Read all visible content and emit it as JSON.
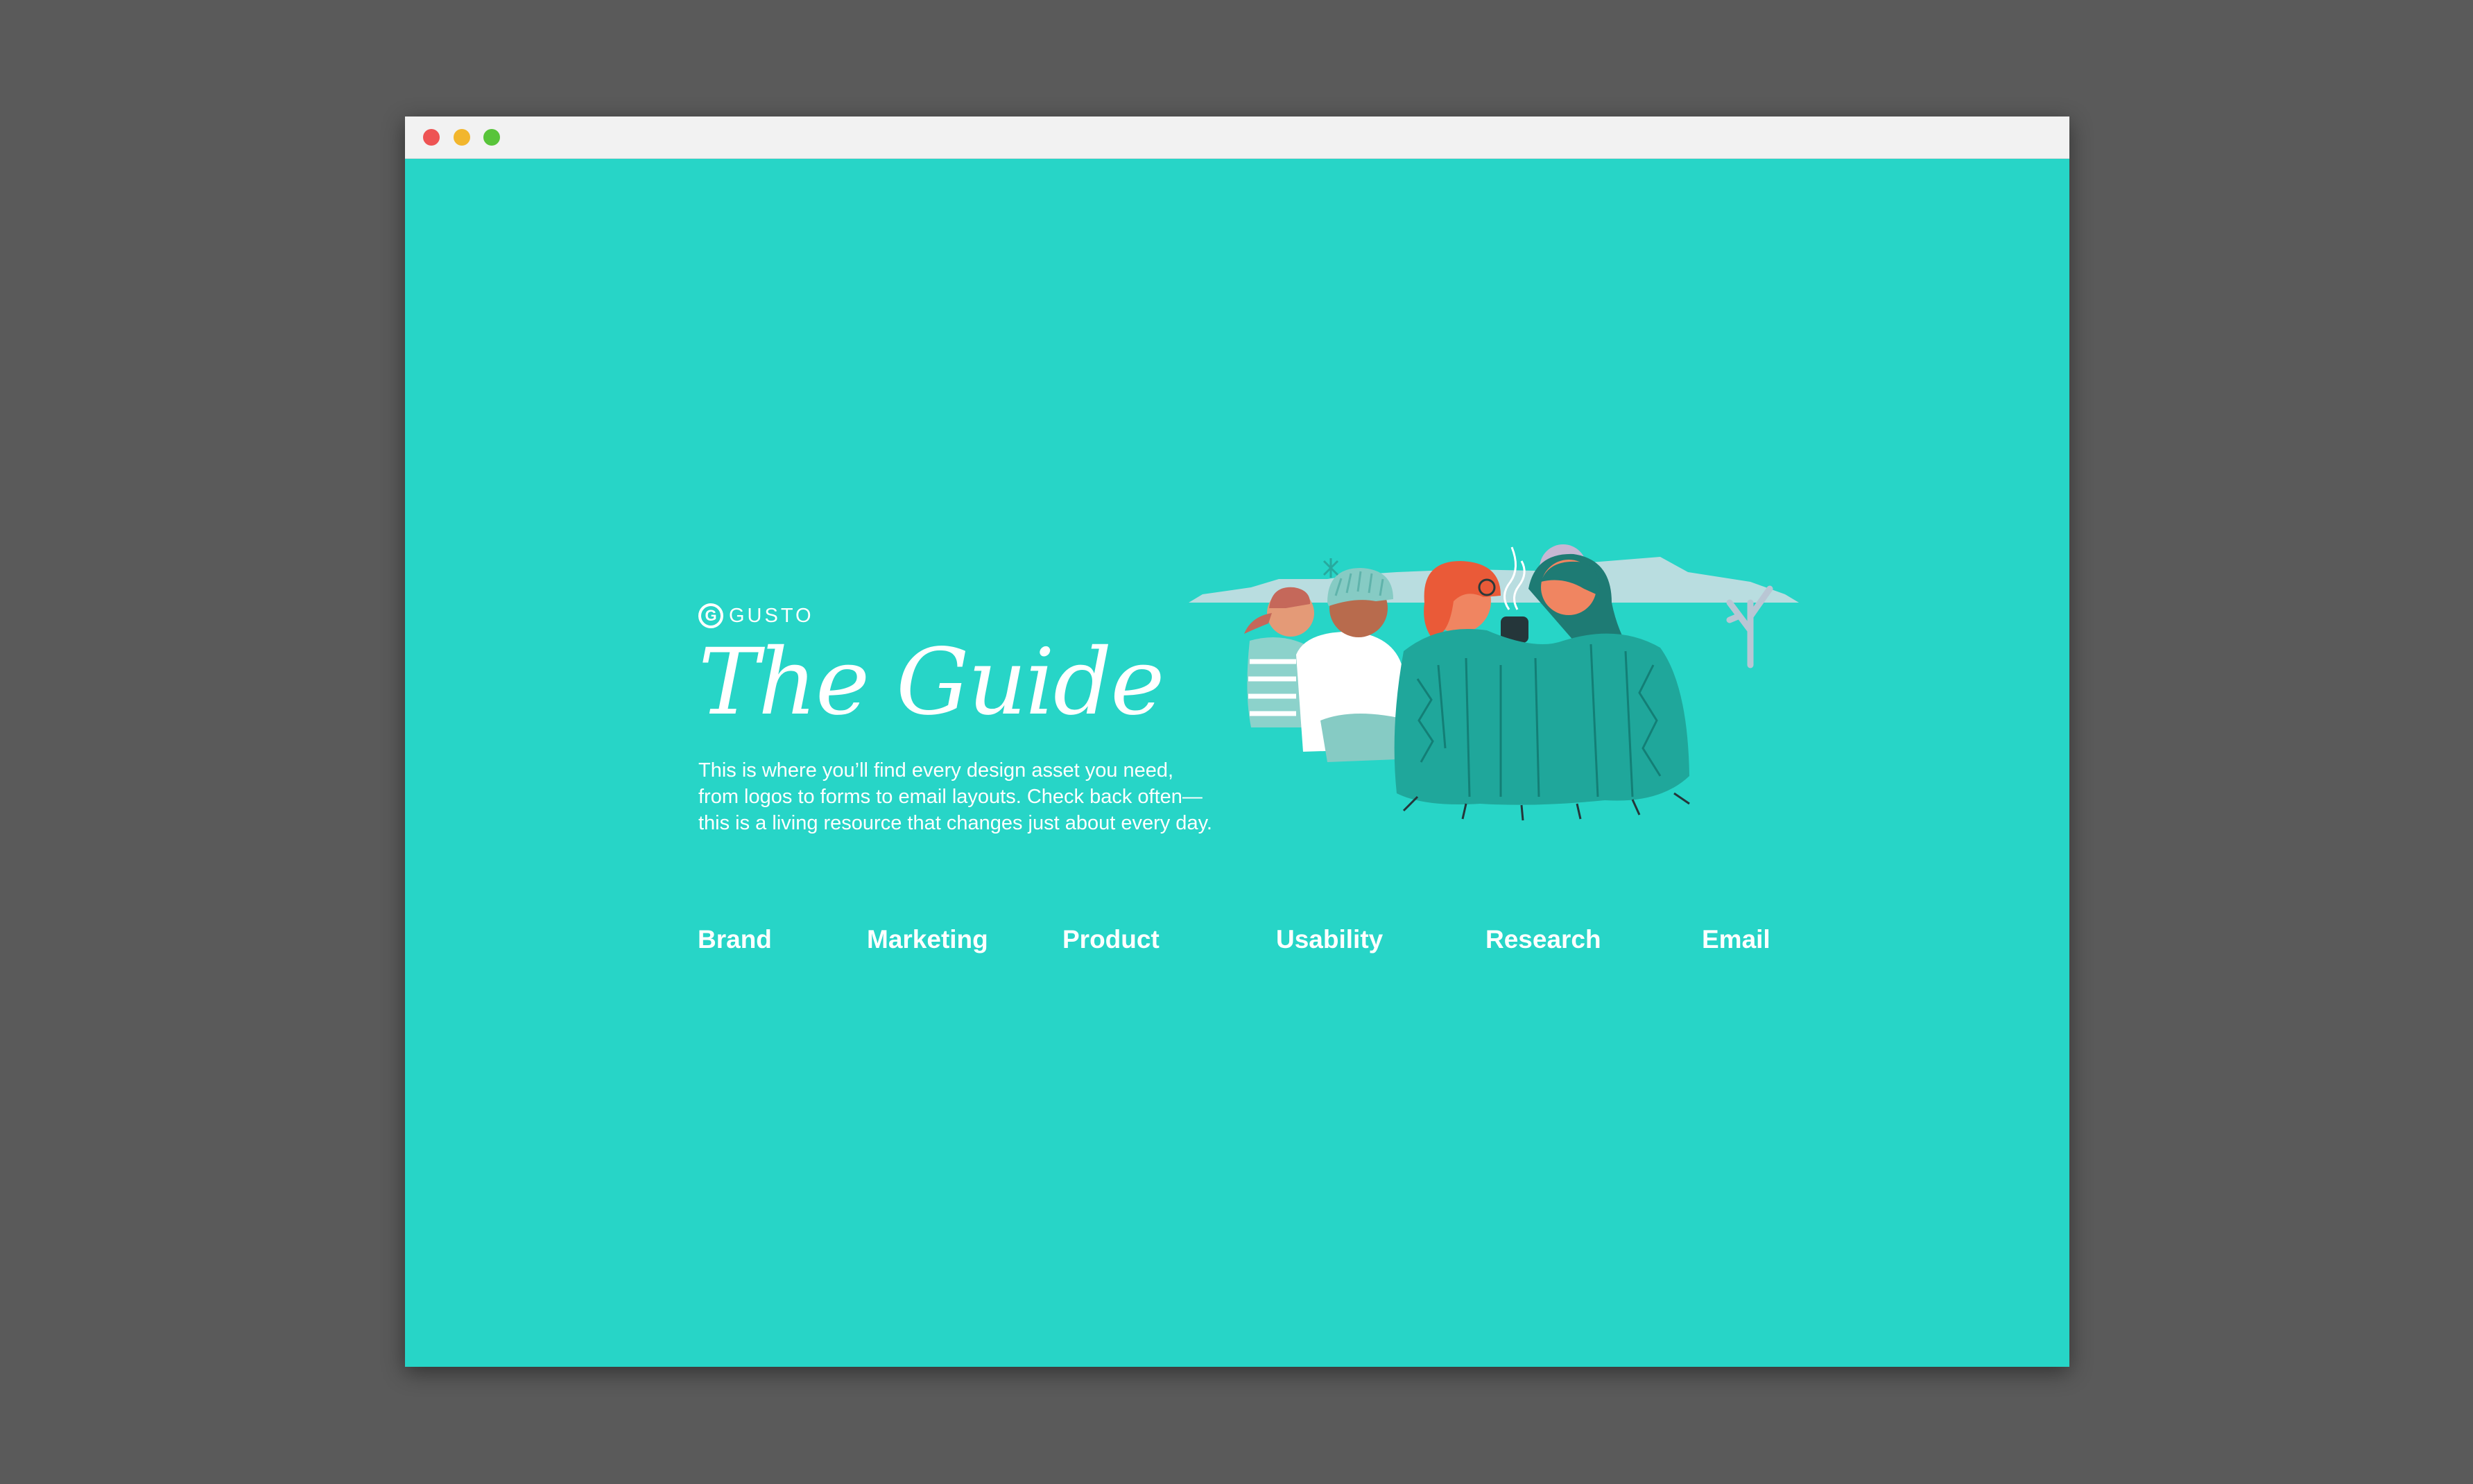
{
  "window": {
    "controls": [
      "close",
      "minimize",
      "maximize"
    ]
  },
  "brand": {
    "logo_letter": "G",
    "logo_text": "GUSTO"
  },
  "hero": {
    "title": "The Guide",
    "description_lines": [
      "This is where you’ll find every design asset you need,",
      "from logos to forms to email layouts. Check back often—",
      "this is a living resource that changes just about every day."
    ]
  },
  "nav": {
    "items": [
      {
        "label": "Brand"
      },
      {
        "label": "Marketing"
      },
      {
        "label": "Product"
      },
      {
        "label": "Usability"
      },
      {
        "label": "Research"
      },
      {
        "label": "Email"
      }
    ]
  },
  "colors": {
    "background": "#27d5c7",
    "desktop": "#5a5a5a",
    "text": "#ffffff",
    "blanket": "#1fa79b"
  }
}
